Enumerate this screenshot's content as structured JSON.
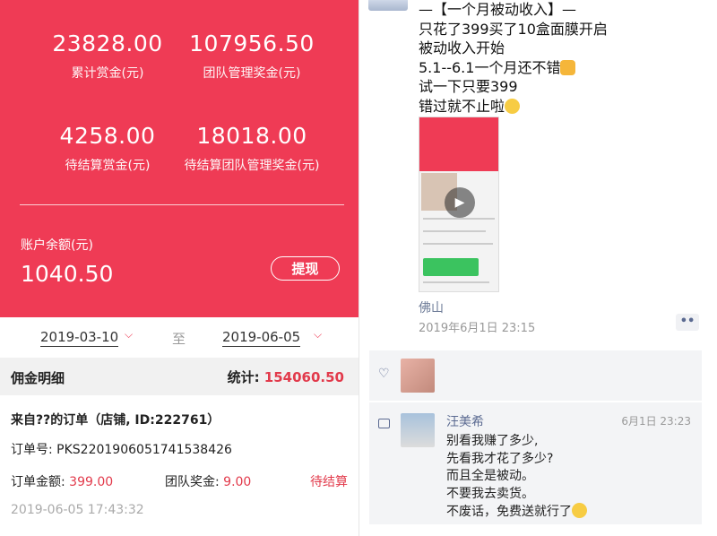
{
  "wallet": {
    "stats": [
      {
        "value": "23828.00",
        "label": "累计赏金(元)"
      },
      {
        "value": "107956.50",
        "label": "团队管理奖金(元)"
      },
      {
        "value": "4258.00",
        "label": "待结算赏金(元)"
      },
      {
        "value": "18018.00",
        "label": "待结算团队管理奖金(元)"
      }
    ],
    "balance_label": "账户余额(元)",
    "balance_value": "1040.50",
    "withdraw_label": "提现",
    "date_from": "2019-03-10",
    "date_to": "2019-06-05",
    "to_label": "至",
    "chevron": "chevron-down-icon",
    "section_title": "佣金明细",
    "total_label": "统计: ",
    "total_value": "154060.50",
    "order": {
      "source": "来自??的订单（店铺, ID:222761）",
      "order_no_label": "订单号: ",
      "order_no": "PKS2201906051741538426",
      "amount_label": "订单金额: ",
      "amount": "399.00",
      "team_label": "团队奖金: ",
      "team_amount": "9.00",
      "status": "待结算",
      "time": "2019-06-05 17:43:32"
    },
    "accent": "#ef3b55"
  },
  "moment": {
    "post_lines": [
      "—【一个月被动收入】—",
      "只花了399买了10盒面膜开启",
      "被动收入开始",
      "5.1--6.1一个月还不错",
      "试一下只要399",
      "错过就不止啦"
    ],
    "location": "佛山",
    "time": "2019年6月1日 23:15",
    "more_label": "••",
    "comment": {
      "name": "汪美希",
      "time": "6月1日 23:23",
      "lines": [
        "别看我赚了多少,",
        "先看我才花了多少?",
        "而且全是被动。",
        "不要我去卖货。",
        "不废话，免费送就行了"
      ]
    },
    "link_color": "#5b6a91"
  }
}
